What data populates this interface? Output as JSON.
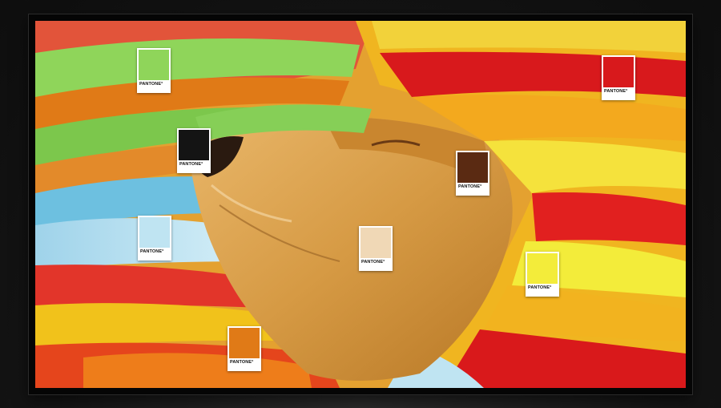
{
  "scene": {
    "subject": "dog-under-blanket"
  },
  "swatches": [
    {
      "brand": "PANTONE°",
      "color": "#8fd55a"
    },
    {
      "brand": "PANTONE°",
      "color": "#141414"
    },
    {
      "brand": "PANTONE°",
      "color": "#bfe4f2"
    },
    {
      "brand": "PANTONE°",
      "color": "#e07a17"
    },
    {
      "brand": "PANTONE°",
      "color": "#f0d8b6"
    },
    {
      "brand": "PANTONE°",
      "color": "#5a2a12"
    },
    {
      "brand": "PANTONE°",
      "color": "#d8191c"
    },
    {
      "brand": "PANTONE°",
      "color": "#f3ec3a"
    }
  ]
}
